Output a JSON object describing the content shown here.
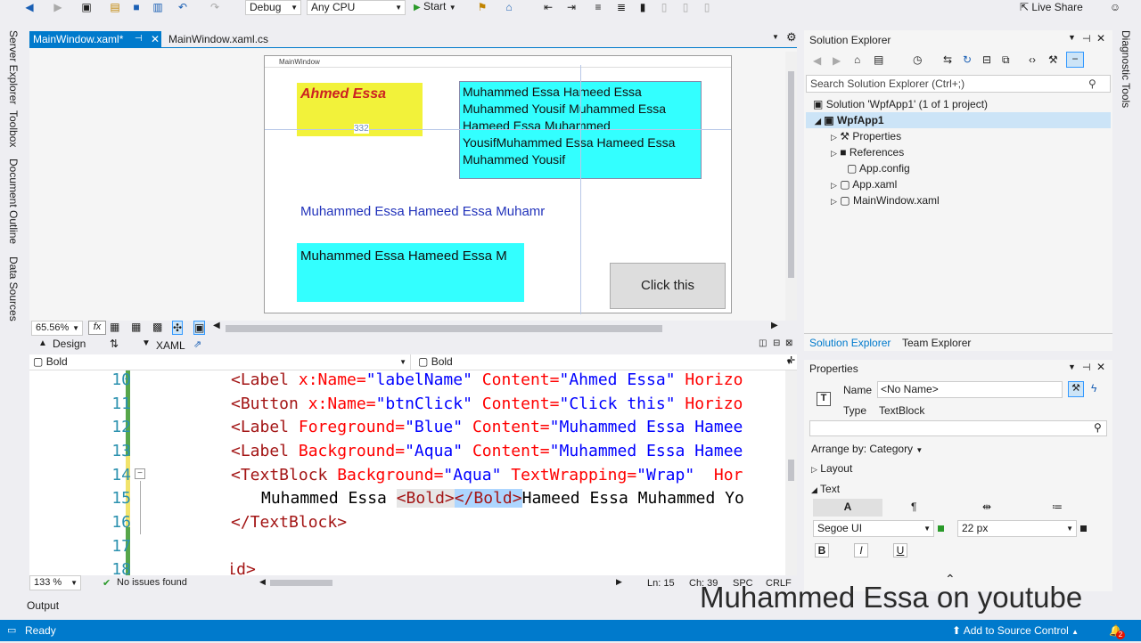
{
  "toolbar": {
    "config": "Debug",
    "platform": "Any CPU",
    "start_label": "Start",
    "live_share": "Live Share"
  },
  "left_tabs": [
    "Server Explorer",
    "Toolbox",
    "Document Outline",
    "Data Sources"
  ],
  "right_tabs": [
    "Diagnostic Tools"
  ],
  "doc_tabs": [
    {
      "label": "MainWindow.xaml*"
    },
    {
      "label": "MainWindow.xaml.cs"
    }
  ],
  "designer": {
    "window_title": "MainWindow",
    "label_ahmed": "Ahmed Essa",
    "width_marker": "332",
    "textblock_text": "Muhammed Essa Hameed Essa Muhammed Yousif Muhammed Essa Hameed Essa Muhammed YousifMuhammed Essa Hameed Essa Muhammed Yousif",
    "label_blue": "Muhammed Essa Hameed Essa Muhamr",
    "label_aqua": "Muhammed Essa Hameed Essa M",
    "button": "Click this",
    "zoom": "65.56%",
    "fx": "fx",
    "tab_design": "Design",
    "tab_xaml": "XAML"
  },
  "nav": {
    "left": "Bold",
    "right": "Bold"
  },
  "code": {
    "line_numbers": [
      "10",
      "11",
      "12",
      "13",
      "14",
      "15",
      "16",
      "17",
      "18"
    ],
    "l10_tag": "<Label",
    "l10_attr1": " x:Name=",
    "l10_val1": "\"labelName\"",
    "l10_attr2": " Content=",
    "l10_val2": "\"Ahmed Essa\"",
    "l10_attr3": " Horizo",
    "l11_tag": "<Button",
    "l11_attr1": " x:Name=",
    "l11_val1": "\"btnClick\"",
    "l11_attr2": " Content=",
    "l11_val2": "\"Click this\"",
    "l11_attr3": " Horizo",
    "l12_tag": "<Label",
    "l12_attr1": " Foreground=",
    "l12_val1": "\"Blue\"",
    "l12_attr2": " Content=",
    "l12_val2": "\"Muhammed Essa Hamee",
    "l13_tag": "<Label",
    "l13_attr1": " Background=",
    "l13_val1": "\"Aqua\"",
    "l13_attr2": " Content=",
    "l13_val2": "\"Muhammed Essa Hamee",
    "l14_tag": "<TextBlock",
    "l14_attr1": " Background=",
    "l14_val1": "\"Aqua\"",
    "l14_attr2": " TextWrapping=",
    "l14_val2": "\"Wrap\"",
    "l14_attr3": "  Hor",
    "l15_text1": "Muhammed Essa ",
    "l15_bold_open": "<Bold>",
    "l15_bold_close": "</Bold>",
    "l15_text2": "Hameed Essa Muhammed Yo",
    "l16_tag": "</TextBlock>",
    "l18_tag": "</Grid>",
    "zoom": "133 %",
    "issues": "No issues found",
    "ln": "Ln: 15",
    "ch": "Ch: 39",
    "spc": "SPC",
    "crlf": "CRLF"
  },
  "solution_explorer": {
    "title": "Solution Explorer",
    "search_placeholder": "Search Solution Explorer (Ctrl+;)",
    "solution": "Solution 'WpfApp1' (1 of 1 project)",
    "project": "WpfApp1",
    "items": [
      "Properties",
      "References",
      "App.config",
      "App.xaml",
      "MainWindow.xaml"
    ],
    "tab1": "Solution Explorer",
    "tab2": "Team Explorer"
  },
  "properties": {
    "title": "Properties",
    "name_label": "Name",
    "name_value": "<No Name>",
    "type_label": "Type",
    "type_value": "TextBlock",
    "arrange": "Arrange by: Category",
    "layout": "Layout",
    "text": "Text",
    "font_family": "Segoe UI",
    "font_size": "22 px"
  },
  "output_tab": "Output",
  "watermark": "Muhammed Essa on youtube",
  "status": {
    "ready": "Ready",
    "source_control": "Add to Source Control",
    "notif_count": "2"
  },
  "colors": {
    "accent": "#007acc",
    "aqua": "#33ffff",
    "yellow": "#f2f23a",
    "label_red": "#cc2222",
    "blue_text": "#2233bb"
  }
}
